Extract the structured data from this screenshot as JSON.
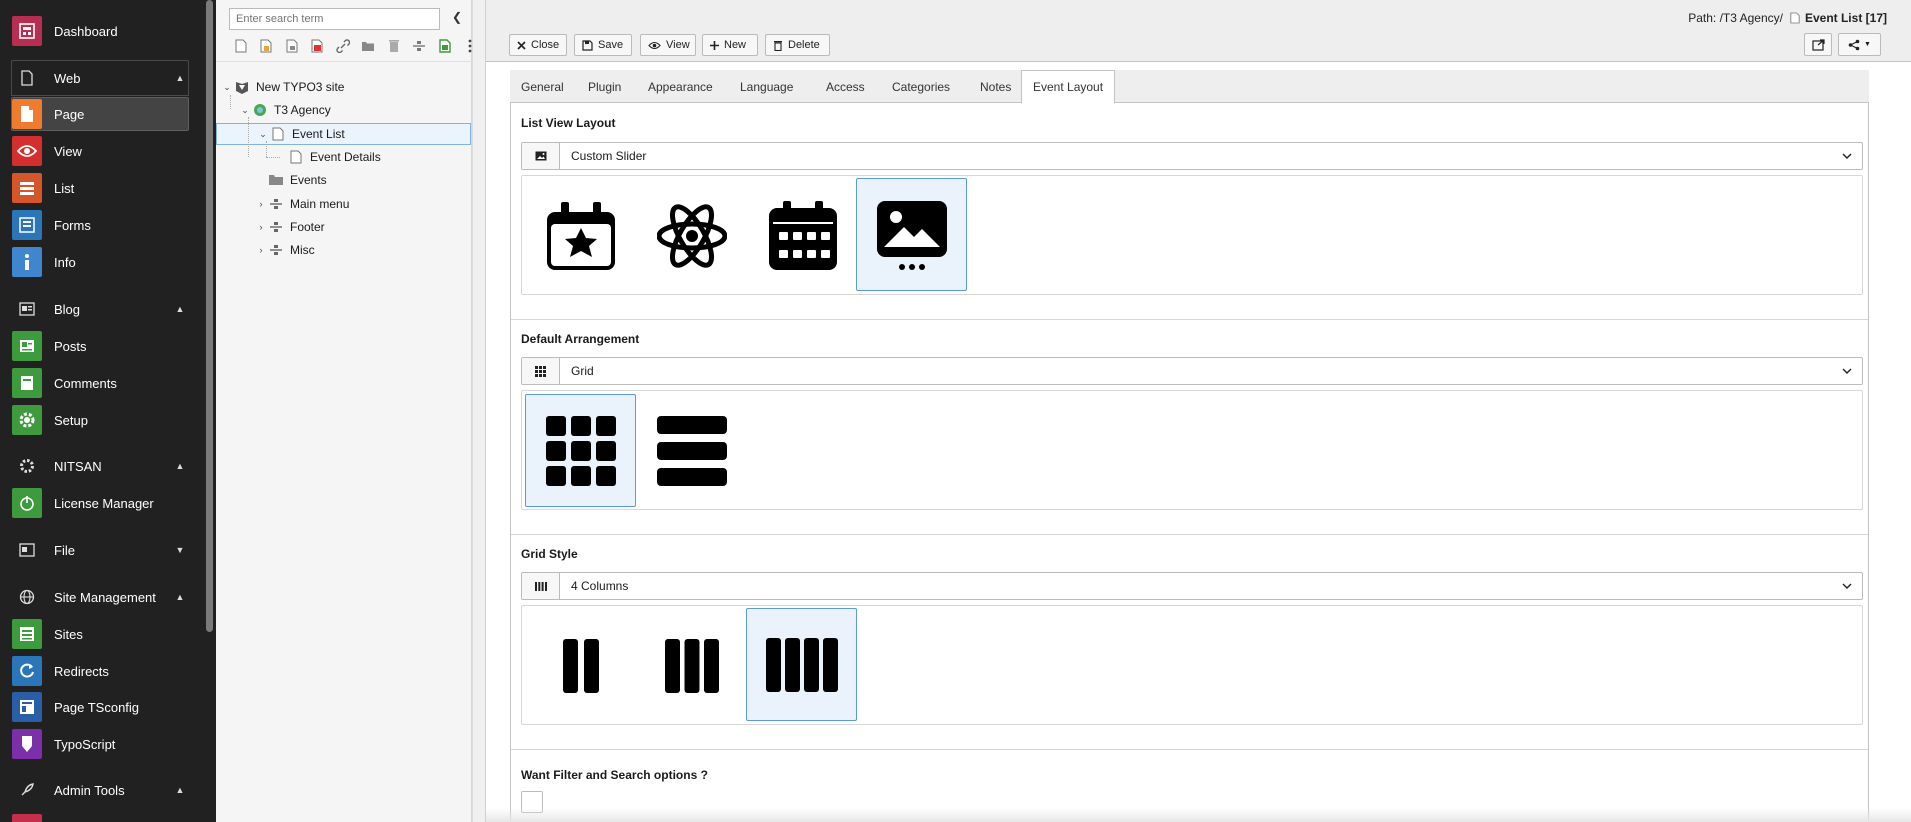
{
  "module_menu": {
    "items": [
      {
        "label": "Dashboard",
        "icon": "dashboard-icon",
        "color": "#b62f52"
      },
      {
        "label": "Web",
        "group": true,
        "chevron": "up"
      },
      {
        "label": "Page",
        "icon": "page-icon",
        "color": "#ef7c2e",
        "active": true
      },
      {
        "label": "View",
        "icon": "view-icon",
        "color": "#d32f2f"
      },
      {
        "label": "List",
        "icon": "list-icon",
        "color": "#d6562b"
      },
      {
        "label": "Forms",
        "icon": "forms-icon",
        "color": "#2a76b8"
      },
      {
        "label": "Info",
        "icon": "info-icon",
        "color": "#3f86cf"
      },
      {
        "label": "Blog",
        "group": true,
        "chevron": "up"
      },
      {
        "label": "Posts",
        "icon": "posts-icon",
        "color": "#3d9a3d"
      },
      {
        "label": "Comments",
        "icon": "comments-icon",
        "color": "#3d9a3d"
      },
      {
        "label": "Setup",
        "icon": "setup-icon",
        "color": "#3d9a3d"
      },
      {
        "label": "NITSAN",
        "group": true,
        "chevron": "up"
      },
      {
        "label": "License Manager",
        "icon": "license-icon",
        "color": "#3d9a3d"
      },
      {
        "label": "File",
        "group": true,
        "chevron": "down"
      },
      {
        "label": "Site Management",
        "group": true,
        "chevron": "up"
      },
      {
        "label": "Sites",
        "icon": "sites-icon",
        "color": "#3d9a3d"
      },
      {
        "label": "Redirects",
        "icon": "redirects-icon",
        "color": "#2a76b8"
      },
      {
        "label": "Page TSconfig",
        "icon": "tsconfig-icon",
        "color": "#2a5fa8"
      },
      {
        "label": "TypoScript",
        "icon": "typoscript-icon",
        "color": "#7b2fa8"
      },
      {
        "label": "Admin Tools",
        "group": true,
        "chevron": "up"
      }
    ]
  },
  "page_tree": {
    "search_placeholder": "Enter search term",
    "toolbar_icons": [
      "new-page-icon",
      "new-page-template-icon",
      "new-page-sub-icon",
      "new-page-external-icon",
      "new-link-icon",
      "new-folder-icon",
      "recycler-icon",
      "new-separator-icon",
      "new-page-green-icon",
      "more-icon"
    ],
    "nodes": [
      {
        "label": "New TYPO3 site"
      },
      {
        "label": "T3 Agency"
      },
      {
        "label": "Event List"
      },
      {
        "label": "Event Details"
      },
      {
        "label": "Events"
      },
      {
        "label": "Main menu"
      },
      {
        "label": "Footer"
      },
      {
        "label": "Misc"
      }
    ]
  },
  "docheader": {
    "path_prefix": "Path: /T3 Agency/",
    "path_title": "Event List [17]",
    "buttons": {
      "close": "Close",
      "save": "Save",
      "view": "View",
      "new": "New",
      "delete": "Delete"
    }
  },
  "tabs": [
    "General",
    "Plugin",
    "Appearance",
    "Language",
    "Access",
    "Categories",
    "Notes",
    "Event Layout"
  ],
  "active_tab": "Event Layout",
  "sections": {
    "list_view_layout": {
      "title": "List View Layout",
      "selected": "Custom Slider",
      "options": [
        "calendar-star-icon",
        "atom-icon",
        "calendar-grid-icon",
        "image-slider-icon"
      ],
      "selected_index": 3
    },
    "default_arrangement": {
      "title": "Default Arrangement",
      "selected": "Grid",
      "options": [
        "grid-icon",
        "list-rows-icon"
      ],
      "selected_index": 0
    },
    "grid_style": {
      "title": "Grid Style",
      "selected": "4 Columns",
      "options": [
        "two-columns-icon",
        "three-columns-icon",
        "four-columns-icon"
      ],
      "selected_index": 2
    },
    "filter": {
      "title": "Want Filter and Search options ?",
      "checked": false
    }
  }
}
